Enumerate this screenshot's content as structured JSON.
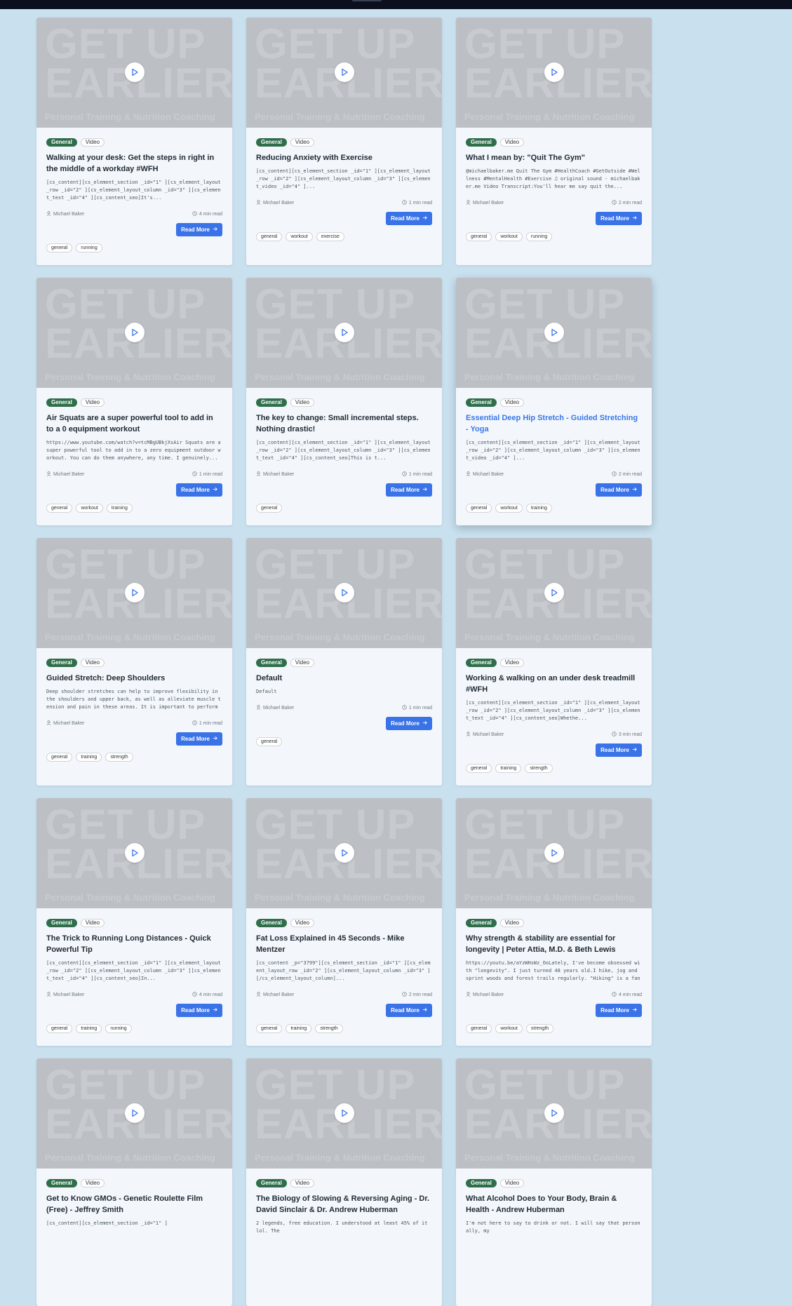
{
  "thumbnail": {
    "headline": "GET UP\nEARLIER",
    "subtitle": "Personal Training & Nutrition Coaching"
  },
  "colors": {
    "category_badge": "#2f6e4a",
    "button": "#3a72e8",
    "link_title": "#3b78e7",
    "page_bg": "#c9e0ef"
  },
  "posts": [
    {
      "category": "General",
      "type": "Video",
      "title": "Walking at your desk: Get the steps in right in the middle of a workday #WFH",
      "excerpt": "[cs_content][cs_element_section _id=\"1\" ][cs_element_layout_row _id=\"2\" ][cs_element_layout_column _id=\"3\" ][cs_element_text _id=\"4\" ][cs_content_seo]It's...",
      "author": "Michael Baker",
      "read_time": "4 min read",
      "button": "Read More",
      "tags": [
        "general",
        "running"
      ]
    },
    {
      "category": "General",
      "type": "Video",
      "title": "Reducing Anxiety with Exercise",
      "excerpt": "[cs_content][cs_element_section _id=\"1\" ][cs_element_layout_row _id=\"2\" ][cs_element_layout_column _id=\"3\" ][cs_element_video _id=\"4\" ]...",
      "author": "Michael Baker",
      "read_time": "1 min read",
      "button": "Read More",
      "tags": [
        "general",
        "workout",
        "exercise"
      ]
    },
    {
      "category": "General",
      "type": "Video",
      "title": "What I mean by: \"Quit The Gym\"",
      "excerpt": "@michaelbaker.me Quit The Gym #HealthCoach #GetOutside #Wellness #MentalHealth #Exercise ♫ original sound - michaelbaker.me Video Transcript:You'll hear me say quit the...",
      "author": "Michael Baker",
      "read_time": "2 min read",
      "button": "Read More",
      "tags": [
        "general",
        "workout",
        "running"
      ]
    },
    {
      "category": "General",
      "type": "Video",
      "title": "Air Squats are a super powerful tool to add in to a 0 equipment workout",
      "excerpt": "https://www.youtube.com/watch?v=tcMBgUBkjXsAir Squats are a super powerful tool to add in to a zero equipment outdoor workout. You can do them anywhere, any time. I genuinely...",
      "author": "Michael Baker",
      "read_time": "1 min read",
      "button": "Read More",
      "tags": [
        "general",
        "workout",
        "training"
      ]
    },
    {
      "category": "General",
      "type": "Video",
      "title": "The key to change: Small incremental steps. Nothing drastic!",
      "excerpt": "[cs_content][cs_element_section _id=\"1\" ][cs_element_layout_row _id=\"2\" ][cs_element_layout_column _id=\"3\" ][cs_element_text _id=\"4\" ][cs_content_seo]This is t...",
      "author": "Michael Baker",
      "read_time": "1 min read",
      "button": "Read More",
      "tags": [
        "general"
      ]
    },
    {
      "category": "General",
      "type": "Video",
      "title": "Essential Deep Hip Stretch - Guided Stretching - Yoga",
      "excerpt": "[cs_content][cs_element_section _id=\"1\" ][cs_element_layout_row _id=\"2\" ][cs_element_layout_column _id=\"3\" ][cs_element_video _id=\"4\" ]...",
      "author": "Michael Baker",
      "read_time": "2 min read",
      "button": "Read More",
      "tags": [
        "general",
        "workout",
        "training"
      ]
    },
    {
      "category": "General",
      "type": "Video",
      "title": "Guided Stretch: Deep Shoulders",
      "excerpt": "Deep shoulder stretches can help to improve flexibility in the shoulders and upper back, as well as alleviate muscle tension and pain in these areas. It is important to perform these...",
      "author": "Michael Baker",
      "read_time": "1 min read",
      "button": "Read More",
      "tags": [
        "general",
        "training",
        "strength"
      ]
    },
    {
      "category": "General",
      "type": "Video",
      "title": "Default",
      "excerpt": "Default",
      "author": "Michael Baker",
      "read_time": "1 min read",
      "button": "Read More",
      "tags": [
        "general"
      ]
    },
    {
      "category": "General",
      "type": "Video",
      "title": "Working & walking on an under desk treadmill #WFH",
      "excerpt": "[cs_content][cs_element_section _id=\"1\" ][cs_element_layout_row _id=\"2\" ][cs_element_layout_column _id=\"3\" ][cs_element_text _id=\"4\" ][cs_content_seo]Whethe...",
      "author": "Michael Baker",
      "read_time": "3 min read",
      "button": "Read More",
      "tags": [
        "general",
        "training",
        "strength"
      ]
    },
    {
      "category": "General",
      "type": "Video",
      "title": "The Trick to Running Long Distances - Quick Powerful Tip",
      "excerpt": "[cs_content][cs_element_section _id=\"1\" ][cs_element_layout_row _id=\"2\" ][cs_element_layout_column _id=\"3\" ][cs_element_text _id=\"4\" ][cs_content_seo]In...",
      "author": "Michael Baker",
      "read_time": "4 min read",
      "button": "Read More",
      "tags": [
        "general",
        "training",
        "running"
      ]
    },
    {
      "category": "General",
      "type": "Video",
      "title": "Fat Loss Explained in 45 Seconds - Mike Mentzer",
      "excerpt": "[cs_content _p=\"3799\"][cs_element_section _id=\"1\" ][cs_element_layout_row _id=\"2\" ][cs_element_layout_column _id=\"3\" ][/cs_element_layout_column]...",
      "author": "Michael Baker",
      "read_time": "2 min read",
      "button": "Read More",
      "tags": [
        "general",
        "training",
        "strength"
      ]
    },
    {
      "category": "General",
      "type": "Video",
      "title": "Why strength & stability are essential for longevity | Peter Attia, M.D. & Beth Lewis",
      "excerpt": "https://youtu.be/aYzWHsWz_OoLately, I've become obsessed with \"longevity\". I just turned 48 years old.I hike, jog and sprint woods and forest trails regularly. \"Hiking\" is a fantastic way to...",
      "author": "Michael Baker",
      "read_time": "4 min read",
      "button": "Read More",
      "tags": [
        "general",
        "workout",
        "strength"
      ]
    },
    {
      "category": "General",
      "type": "Video",
      "title": "Get to Know GMOs - Genetic Roulette Film (Free) - Jeffrey Smith",
      "excerpt": "[cs_content][cs_element_section _id=\"1\" ]",
      "author": "",
      "read_time": "",
      "button": "",
      "tags": []
    },
    {
      "category": "General",
      "type": "Video",
      "title": "The Biology of Slowing & Reversing Aging - Dr. David Sinclair & Dr. Andrew Huberman",
      "excerpt": "2 legends, free education. I understood at least 45% of it lol. The",
      "author": "",
      "read_time": "",
      "button": "",
      "tags": []
    },
    {
      "category": "General",
      "type": "Video",
      "title": "What Alcohol Does to Your Body, Brain & Health - Andrew Huberman",
      "excerpt": "I'm not here to say to drink or not. I will say that personally, my",
      "author": "",
      "read_time": "",
      "button": "",
      "tags": []
    }
  ]
}
